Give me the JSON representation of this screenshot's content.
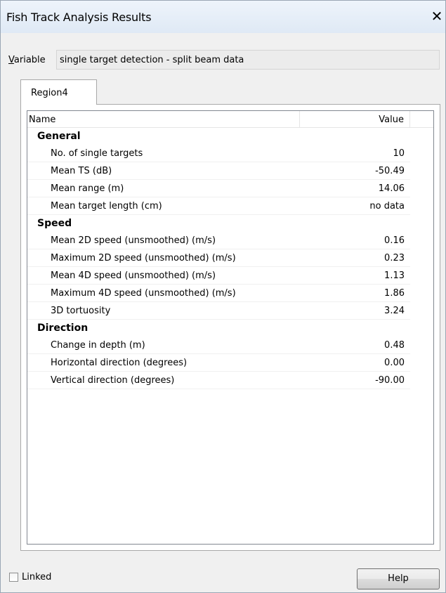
{
  "window": {
    "title": "Fish Track Analysis Results",
    "close_glyph": "✕"
  },
  "variable": {
    "label_access_key": "V",
    "label_rest": "ariable",
    "value": "single target detection - split beam data"
  },
  "tabs": [
    {
      "label": "Region4",
      "selected": true
    }
  ],
  "table": {
    "columns": [
      "Name",
      "Value"
    ],
    "groups": [
      {
        "name": "General",
        "rows": [
          {
            "name": "No. of single targets",
            "value": "10"
          },
          {
            "name": "Mean TS (dB)",
            "value": "-50.49"
          },
          {
            "name": "Mean range (m)",
            "value": "14.06"
          },
          {
            "name": "Mean target length (cm)",
            "value": "no data"
          }
        ]
      },
      {
        "name": "Speed",
        "rows": [
          {
            "name": "Mean 2D speed (unsmoothed) (m/s)",
            "value": "0.16"
          },
          {
            "name": "Maximum 2D speed (unsmoothed) (m/s)",
            "value": "0.23"
          },
          {
            "name": "Mean 4D speed (unsmoothed) (m/s)",
            "value": "1.13"
          },
          {
            "name": "Maximum 4D speed (unsmoothed) (m/s)",
            "value": "1.86"
          },
          {
            "name": "3D tortuosity",
            "value": "3.24"
          }
        ]
      },
      {
        "name": "Direction",
        "rows": [
          {
            "name": "Change in depth (m)",
            "value": "0.48"
          },
          {
            "name": "Horizontal direction (degrees)",
            "value": "0.00"
          },
          {
            "name": "Vertical direction (degrees)",
            "value": "-90.00"
          }
        ]
      }
    ]
  },
  "footer": {
    "linked_label": "Linked",
    "linked_checked": false,
    "help_label": "Help"
  }
}
